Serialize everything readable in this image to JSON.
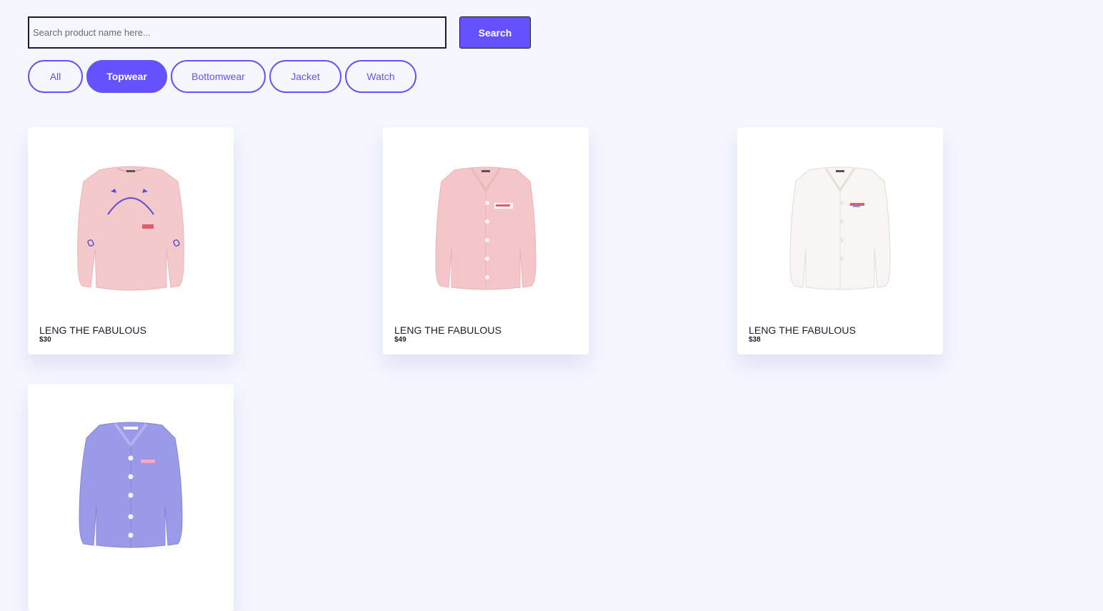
{
  "search": {
    "placeholder": "Search product name here...",
    "button_label": "Search"
  },
  "filters": [
    {
      "label": "All",
      "active": false
    },
    {
      "label": "Topwear",
      "active": true
    },
    {
      "label": "Bottomwear",
      "active": false
    },
    {
      "label": "Jacket",
      "active": false
    },
    {
      "label": "Watch",
      "active": false
    }
  ],
  "colors": {
    "accent": "#6452ff",
    "background": "#f4f7fe"
  },
  "products": [
    {
      "name": "LENG THE FABULOUS",
      "price": "$30",
      "image": "pink-sweatshirt"
    },
    {
      "name": "LENG THE FABULOUS",
      "price": "$49",
      "image": "pink-cardigan"
    },
    {
      "name": "LENG THE FABULOUS",
      "price": "$38",
      "image": "white-cardigan"
    },
    {
      "name": "",
      "price": "",
      "image": "lavender-cardigan"
    }
  ]
}
